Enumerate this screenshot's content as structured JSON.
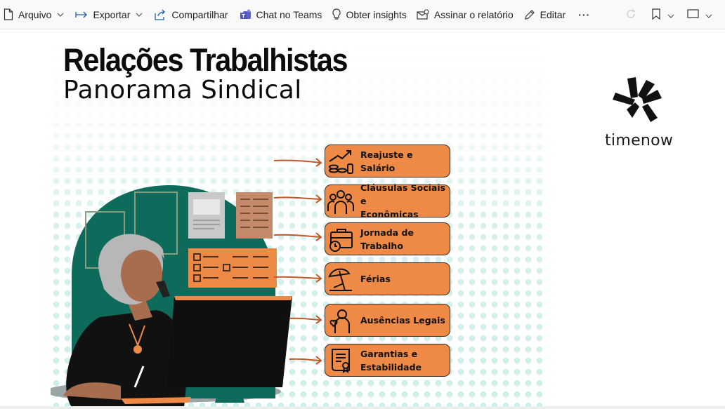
{
  "toolbar": {
    "file_label": "Arquivo",
    "export_label": "Exportar",
    "share_label": "Compartilhar",
    "teams_label": "Chat no Teams",
    "insights_label": "Obter insights",
    "subscribe_label": "Assinar o relatório",
    "edit_label": "Editar",
    "more_label": "···"
  },
  "report": {
    "title": "Relações Trabalhistas",
    "subtitle": "Panorama Sindical",
    "logo_text": "timenow",
    "topics": [
      {
        "line1": "Reajuste e Salário",
        "line2": "",
        "icon": "salary-growth-icon"
      },
      {
        "line1": "Cláusulas Sociais e",
        "line2": "Econômicas",
        "icon": "people-group-icon"
      },
      {
        "line1": "Jornada de",
        "line2": "Trabalho",
        "icon": "briefcase-clock-icon"
      },
      {
        "line1": "Férias",
        "line2": "",
        "icon": "beach-umbrella-icon"
      },
      {
        "line1": "Ausências Legais",
        "line2": "",
        "icon": "person-heart-icon"
      },
      {
        "line1": "Garantias e",
        "line2": "Estabilidade",
        "icon": "certificate-icon"
      }
    ]
  },
  "colors": {
    "accent_orange": "#ee8a45",
    "dark_green": "#0e6b5c",
    "dot_teal": "#cdeeea"
  }
}
